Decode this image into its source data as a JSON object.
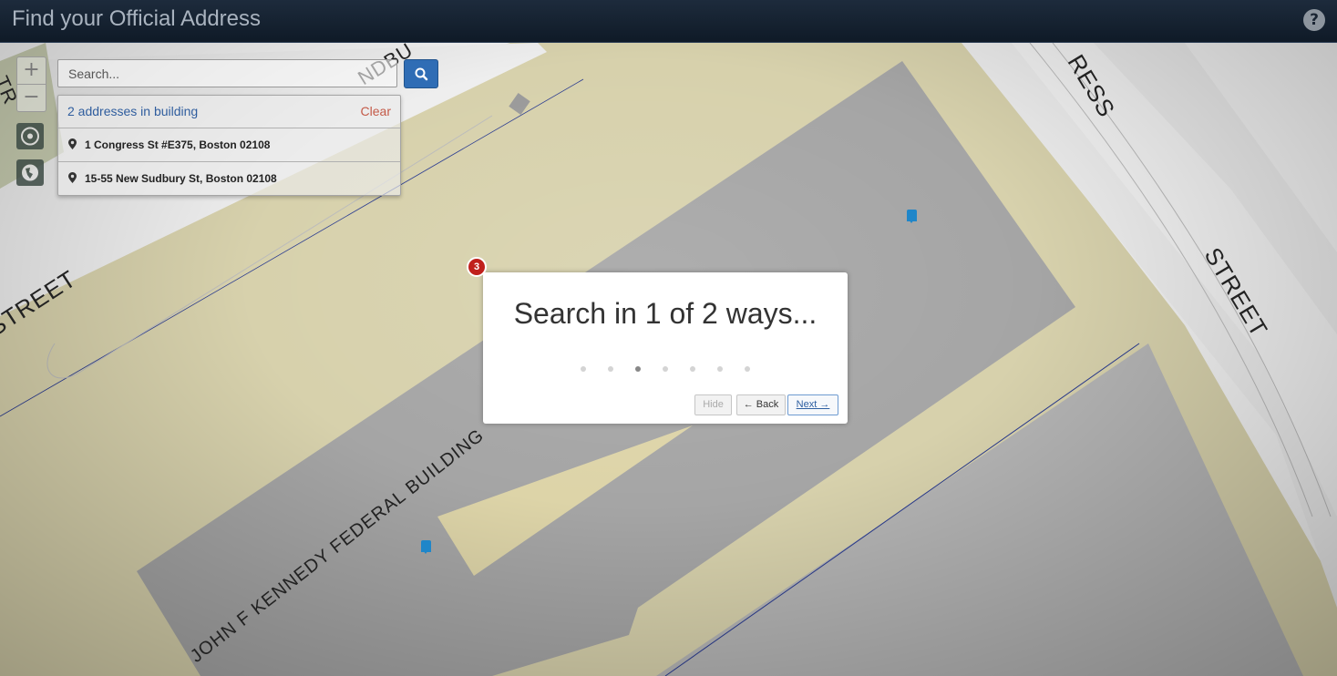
{
  "header": {
    "title": "Find your Official Address",
    "help_icon": "question-circle-icon"
  },
  "map": {
    "zoom_in_label": "+",
    "zoom_out_label": "−",
    "labels": {
      "street_left": "STREET",
      "street_right": "STREET",
      "congress_fragment": "RESS",
      "sudbury_fragment": "NDBU",
      "top_left_fragment": "TR",
      "building": "JOHN  F  KENNEDY  FEDERAL  BUILDING"
    },
    "colors": {
      "road": "#f3f3f3",
      "sidewalk": "#d5d0b4",
      "building": "#9c9c9c",
      "plaza": "#e9e1b4"
    }
  },
  "search": {
    "placeholder": "Search...",
    "results_count": "2 addresses in building",
    "clear_label": "Clear",
    "results": [
      "1 Congress St #E375, Boston 02108",
      "15-55 New Sudbury St, Boston 02108"
    ]
  },
  "tour": {
    "step_badge": "3",
    "title": "Search in 1 of 2 ways...",
    "total_steps": 7,
    "current_step": 3,
    "hide_label": "Hide",
    "back_label": "← Back",
    "next_label": "Next →"
  }
}
